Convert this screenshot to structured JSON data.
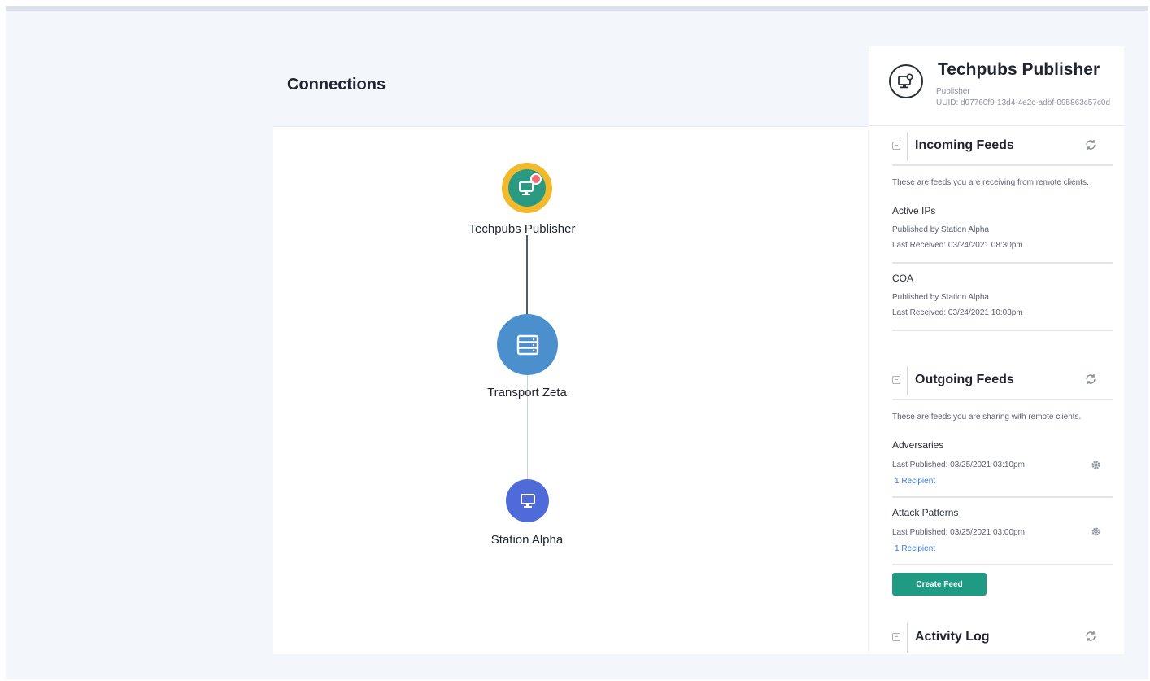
{
  "main": {
    "title": "Connections",
    "graph": {
      "nodes": [
        {
          "label": "Techpubs Publisher",
          "icon": "monitor-gear-icon",
          "color": "#2a9a83",
          "ring": "#f2b92c"
        },
        {
          "label": "Transport Zeta",
          "icon": "server-icon",
          "color": "#4b8fcd"
        },
        {
          "label": "Station Alpha",
          "icon": "monitor-icon",
          "color": "#4f6bd9"
        }
      ]
    }
  },
  "side": {
    "name": "Techpubs Publisher",
    "role": "Publisher",
    "uuid": "UUID: d07760f9-13d4-4e2c-adbf-095863c57c0d",
    "incoming": {
      "title": "Incoming Feeds",
      "description": "These are feeds you are receiving from remote clients.",
      "feeds": [
        {
          "name": "Active IPs",
          "published_by": "Published by Station Alpha",
          "last": "Last Received: 03/24/2021 08:30pm"
        },
        {
          "name": "COA",
          "published_by": "Published by Station Alpha",
          "last": "Last Received: 03/24/2021 10:03pm"
        }
      ]
    },
    "outgoing": {
      "title": "Outgoing Feeds",
      "description": "These are feeds you are sharing with remote clients.",
      "feeds": [
        {
          "name": "Adversaries",
          "last": "Last Published: 03/25/2021 03:10pm",
          "recipients": "1 Recipient"
        },
        {
          "name": "Attack Patterns",
          "last": "Last Published: 03/25/2021 03:00pm",
          "recipients": "1 Recipient"
        }
      ],
      "create_label": "Create Feed"
    },
    "activity": {
      "title": "Activity Log"
    }
  },
  "colors": {
    "accent": "#1f9b84",
    "link": "#3b7bd0",
    "background": "#f3f6fa"
  }
}
